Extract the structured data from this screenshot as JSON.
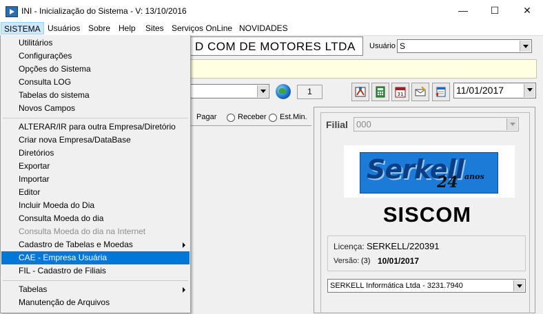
{
  "window": {
    "title": "INI - Inicialização do Sistema - V: 13/10/2016"
  },
  "menubar": [
    "SISTEMA",
    "Usuários",
    "Sobre",
    "Help",
    "Sites",
    "Serviços OnLine",
    "NOVIDADES"
  ],
  "menu": {
    "group1": [
      "Utilitários",
      "Configurações",
      "Opções do Sistema",
      "Consulta LOG",
      "Tabelas do sistema",
      "Novos Campos"
    ],
    "group2": [
      "ALTERAR/IR para outra Empresa/Diretório",
      "Criar nova Empresa/DataBase",
      "Diretórios",
      "Exportar",
      "Importar",
      "Editor",
      "Incluir Moeda do Dia",
      "Consulta Moeda do dia",
      "Consulta Moeda do dia na Internet",
      "Cadastro de Tabelas e Moedas",
      "CAE - Empresa Usuária",
      "FIL - Cadastro de Filiais"
    ],
    "group3": [
      "Tabelas",
      "Manutenção de Arquivos"
    ],
    "disabled_item": "Consulta Moeda do dia na Internet",
    "highlighted_item": "CAE - Empresa Usuária",
    "submenu_items": [
      "Cadastro de Tabelas e Moedas",
      "Tabelas"
    ]
  },
  "main": {
    "company_text": "D COM DE MOTORES LTDA",
    "usuario_label": "Usuário",
    "usuario_value": "S",
    "counter_value": "1",
    "date_value": "11/01/2017",
    "radio_options": [
      "Pagar",
      "Receber",
      "Est.Min."
    ]
  },
  "panel": {
    "filial_label": "Filial",
    "filial_value": "000",
    "logo_text": "Serkell",
    "logo_years": "24",
    "logo_anos": "anos",
    "product_name": "SISCOM",
    "licenca_label": "Licença:",
    "licenca_value": "SERKELL/220391",
    "versao_label": "Versão:",
    "versao_num": "(3)",
    "versao_value": "10/01/2017",
    "contact_value": "SERKELL Informática Ltda - 3231.7940"
  },
  "colors": {
    "menu_highlight": "#0078d7",
    "menubar_active": "#cce8ff",
    "yellow_bar": "#ffffe1"
  }
}
